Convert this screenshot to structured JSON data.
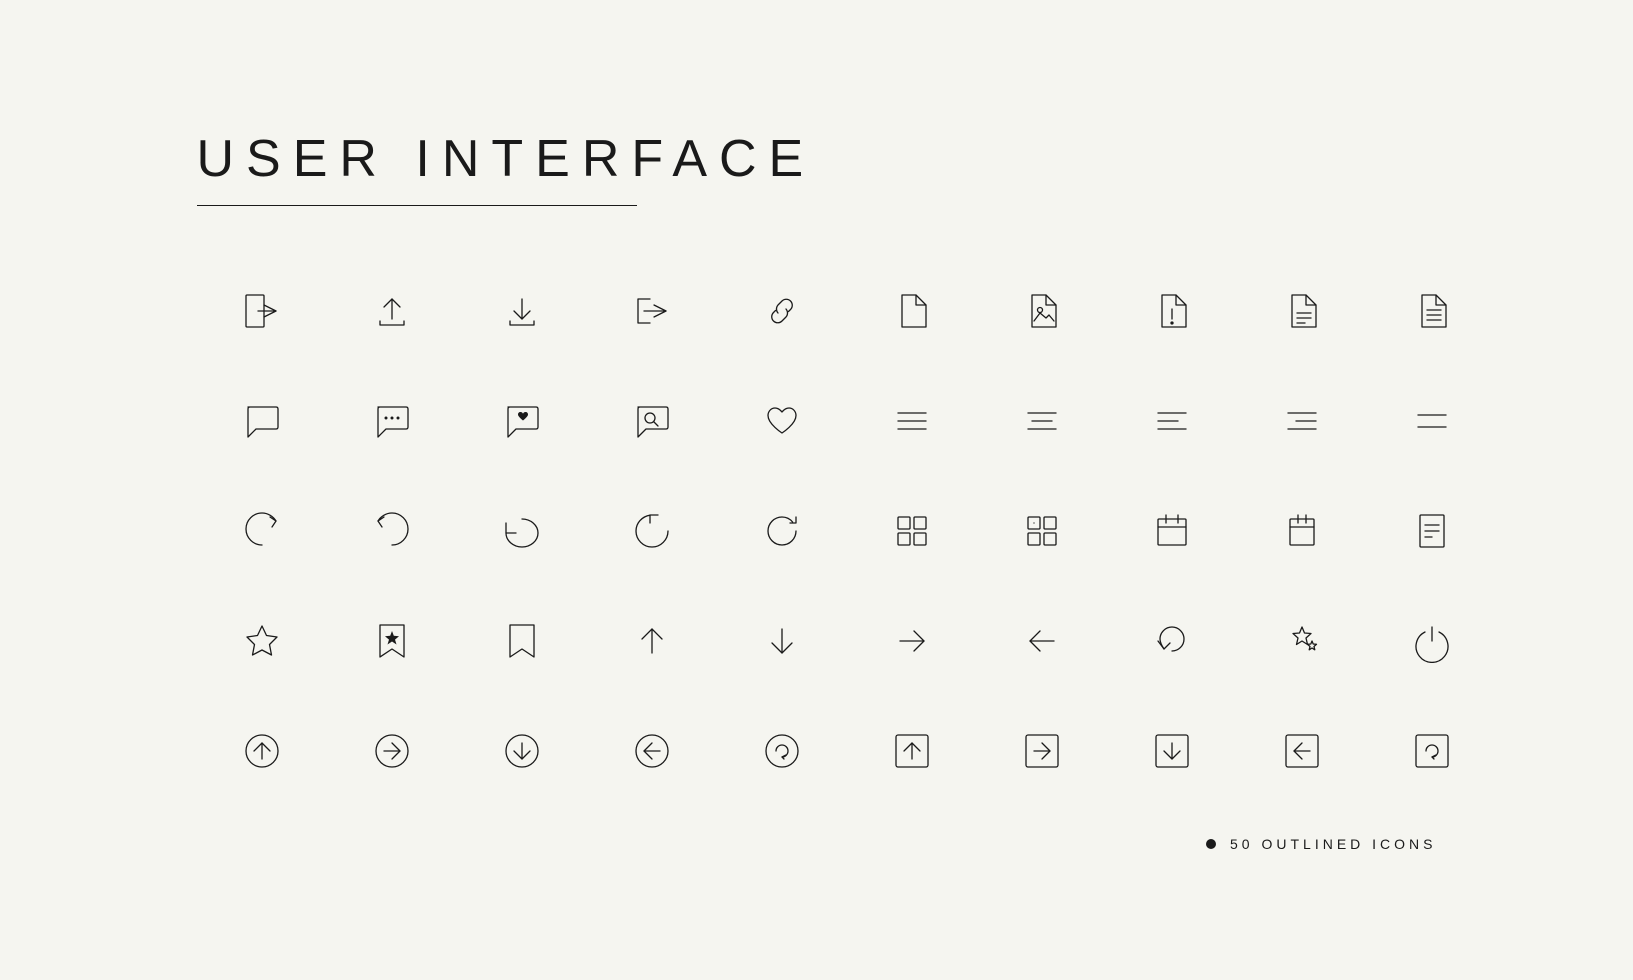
{
  "title": "USER INTERFACE",
  "footer": {
    "dot": true,
    "label": "50 OUTLINED ICONS"
  },
  "rows": [
    {
      "icons": [
        "logout",
        "upload",
        "download",
        "login",
        "link",
        "file-blank",
        "file-image",
        "file-alert",
        "file-list",
        "file-text"
      ]
    },
    {
      "icons": [
        "chat",
        "chat-dots",
        "chat-heart",
        "chat-search",
        "heart",
        "menu",
        "menu-center",
        "menu-short",
        "menu-right",
        "menu-minimal"
      ]
    },
    {
      "icons": [
        "refresh-ccw",
        "refresh-cw",
        "reload-partial",
        "reload-dot",
        "reload",
        "grid-2x2",
        "grid-feature",
        "calendar",
        "calendar-small",
        "notes"
      ]
    },
    {
      "icons": [
        "star",
        "bookmark-star",
        "bookmark",
        "arrow-up",
        "arrow-down",
        "arrow-right",
        "arrow-left",
        "undo",
        "stars",
        "power"
      ]
    },
    {
      "icons": [
        "circle-up",
        "circle-right",
        "circle-down",
        "circle-left",
        "circle-redo",
        "square-up",
        "square-right",
        "square-down",
        "square-left",
        "square-redo"
      ]
    }
  ]
}
